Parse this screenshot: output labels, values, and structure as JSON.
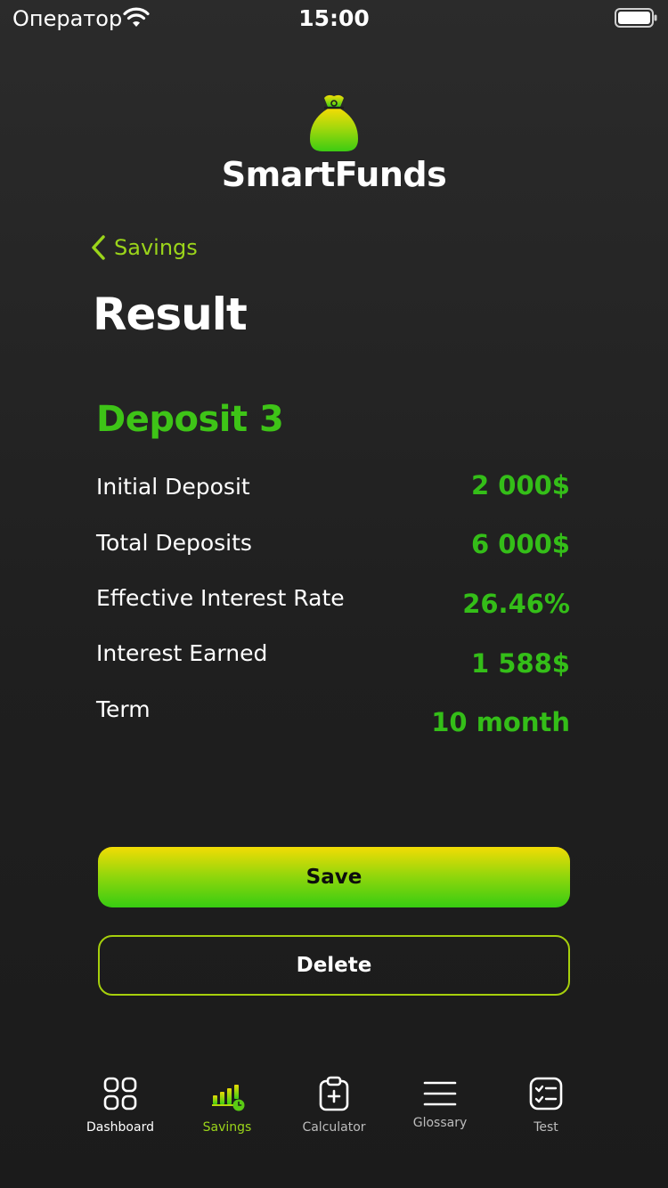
{
  "status_bar": {
    "carrier": "Оператор",
    "time": "15:00"
  },
  "app": {
    "name": "SmartFunds",
    "logo_icon": "money-bag-icon"
  },
  "nav": {
    "back_label": "Savings"
  },
  "page": {
    "title": "Result"
  },
  "deposit": {
    "name": "Deposit 3",
    "rows": [
      {
        "label": "Initial Deposit",
        "value": "2 000$"
      },
      {
        "label": "Total Deposits",
        "value": "6 000$"
      },
      {
        "label": "Effective Interest Rate",
        "value": "26.46%"
      },
      {
        "label": "Interest Earned",
        "value": "1 588$"
      },
      {
        "label": "Term",
        "value": "10 month"
      }
    ]
  },
  "actions": {
    "save_label": "Save",
    "delete_label": "Delete"
  },
  "tabbar": {
    "items": [
      {
        "label": "Dashboard",
        "icon": "grid-icon"
      },
      {
        "label": "Savings",
        "icon": "bar-chart-clock-icon",
        "active": true
      },
      {
        "label": "Calculator",
        "icon": "clipboard-plus-icon"
      },
      {
        "label": "Glossary",
        "icon": "menu-lines-icon"
      },
      {
        "label": "Test",
        "icon": "checklist-icon"
      }
    ]
  },
  "colors": {
    "accent_green": "#3ec417",
    "accent_lime": "#9bd51a",
    "gradient_top": "#f2dc05",
    "gradient_bottom": "#37cc12",
    "background": "#222222"
  }
}
